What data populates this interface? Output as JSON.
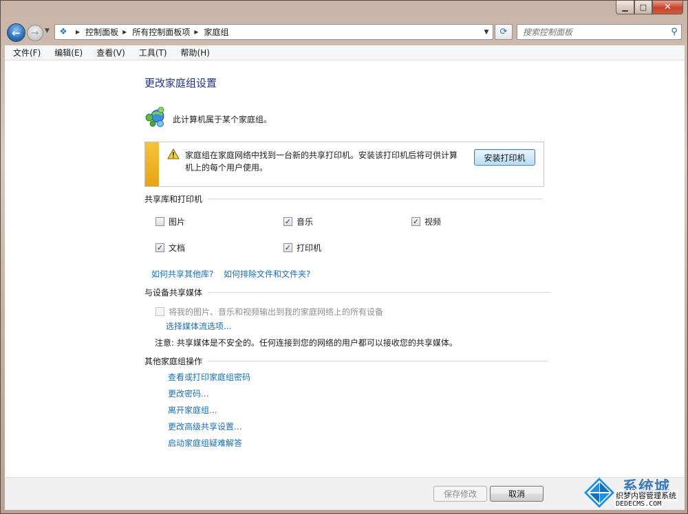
{
  "window": {
    "caption": {
      "minimize": "▁",
      "maximize": "□",
      "close": "✕"
    }
  },
  "nav": {
    "back": "←",
    "forward": "→",
    "breadcrumb": [
      "控制面板",
      "所有控制面板项",
      "家庭组"
    ],
    "search_placeholder": "搜索控制面板"
  },
  "menu": [
    "文件(F)",
    "编辑(E)",
    "查看(V)",
    "工具(T)",
    "帮助(H)"
  ],
  "page": {
    "title": "更改家庭组设置",
    "membership": "此计算机属于某个家庭组。",
    "notice": {
      "text": "家庭组在家庭网络中找到一台新的共享打印机。安装该打印机后将可供计算机上的每个用户使用。",
      "button": "安装打印机"
    },
    "libraries": {
      "heading": "共享库和打印机",
      "items": [
        {
          "label": "图片",
          "checked": false
        },
        {
          "label": "音乐",
          "checked": true
        },
        {
          "label": "视频",
          "checked": true
        },
        {
          "label": "文档",
          "checked": true
        },
        {
          "label": "打印机",
          "checked": true
        }
      ],
      "links": [
        "如何共享其他库?",
        "如何排除文件和文件夹?"
      ]
    },
    "media": {
      "heading": "与设备共享媒体",
      "checkbox_label": "将我的图片、音乐和视频输出到我的家庭网络上的所有设备",
      "checked": false,
      "link": "选择媒体流选项...",
      "note": "注意: 共享媒体是不安全的。任何连接到您的网络的用户都可以接收您的共享媒体。"
    },
    "other": {
      "heading": "其他家庭组操作",
      "links": [
        "查看或打印家庭组密码",
        "更改密码...",
        "离开家庭组...",
        "更改高级共享设置...",
        "启动家庭组疑难解答"
      ]
    }
  },
  "footer": {
    "save": "保存修改",
    "cancel": "取消"
  },
  "watermark": {
    "title": "系统城",
    "subtitle": "织梦内容管理系统",
    "url": "DEDECMS.COM"
  },
  "colors": {
    "link": "#1a6fb5",
    "title": "#1e3287",
    "warning_bar": "#f4c33a"
  }
}
